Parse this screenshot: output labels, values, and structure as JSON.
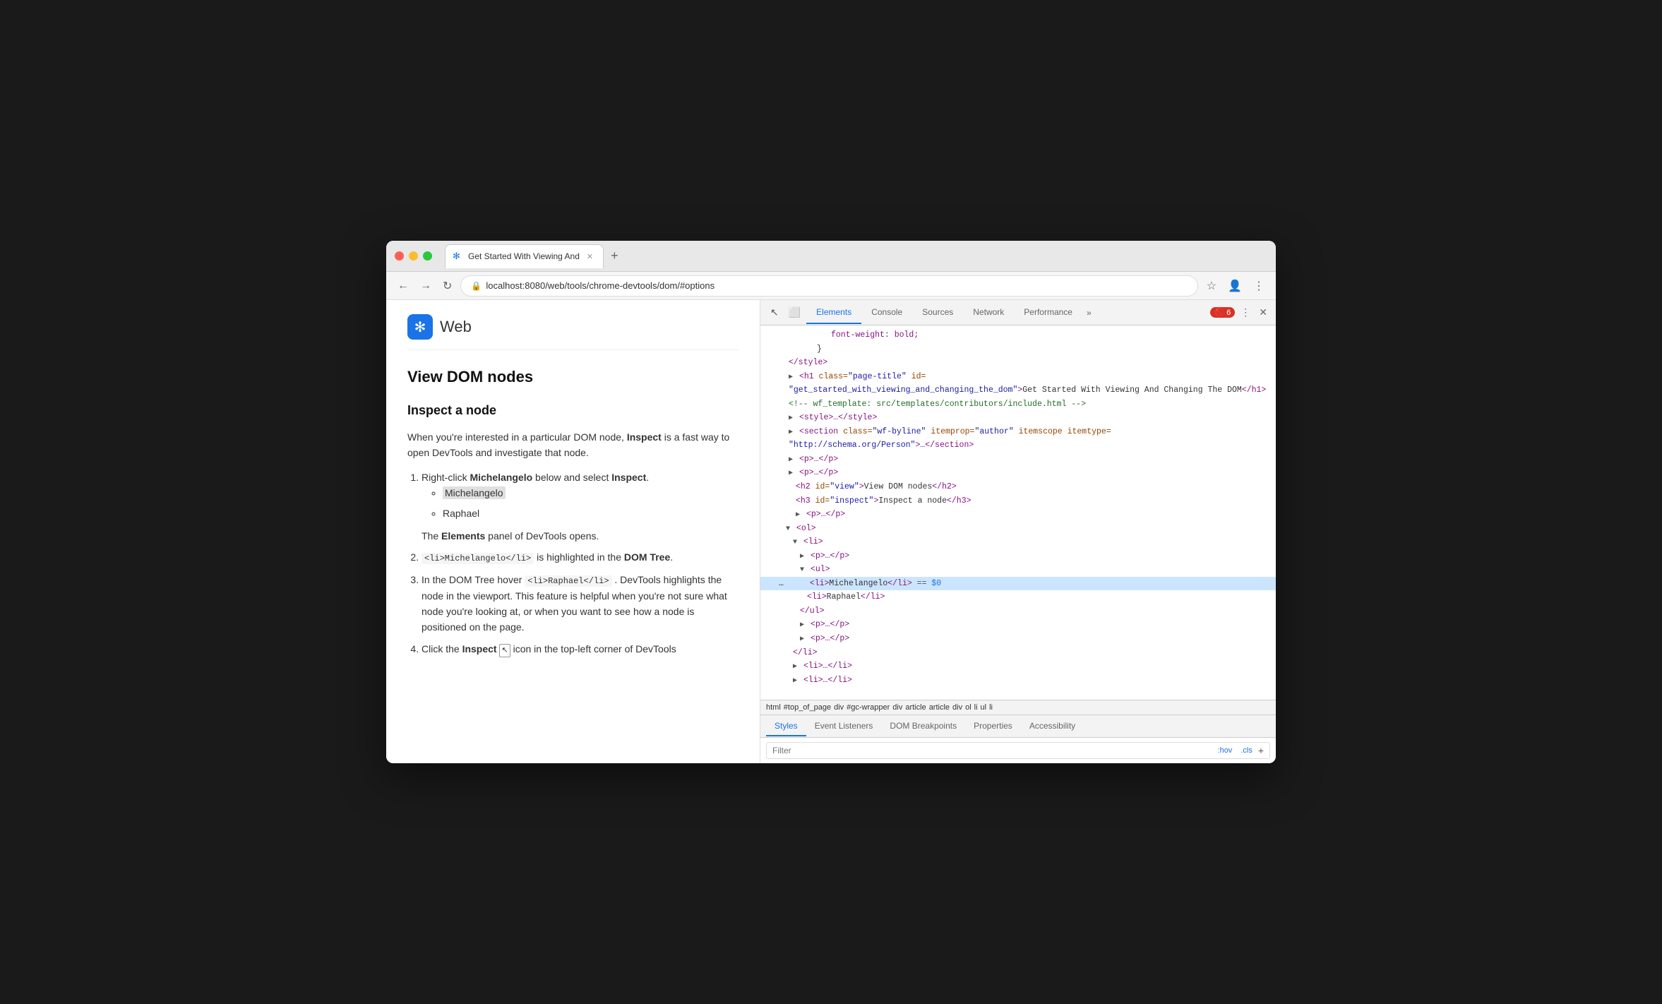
{
  "browser": {
    "tab_title": "Get Started With Viewing And",
    "tab_favicon": "⚙",
    "address": "localhost:8080/web/tools/chrome-devtools/dom/#options",
    "nav": {
      "back": "←",
      "forward": "→",
      "reload": "↻"
    }
  },
  "webpage": {
    "logo": "✻",
    "site_title": "Web",
    "heading": "View DOM nodes",
    "subheading": "Inspect a node",
    "intro": "When you're interested in a particular DOM node, Inspect is a fast way to open DevTools and investigate that node.",
    "steps": [
      {
        "text_before": "Right-click ",
        "bold1": "Michelangelo",
        "text_middle": " below and select ",
        "bold2": "Inspect",
        "text_after": ".",
        "list_items": [
          "Michelangelo",
          "Raphael"
        ],
        "highlight_index": 0
      },
      {
        "text_before": "The ",
        "bold1": "Elements",
        "text_after": " panel of DevTools opens."
      },
      {
        "code": "<li>Michelangelo</li>",
        "text_after": " is highlighted in the ",
        "bold": "DOM Tree",
        "period": "."
      },
      {
        "text_before": "In the DOM Tree hover ",
        "code": "<li>Raphael</li>",
        "text_after": " . DevTools highlights the node in the viewport. This feature is helpful when you're not sure what node you're looking at, or when you want to see how a node is positioned on the page."
      },
      {
        "text_before": "Click the ",
        "bold": "Inspect",
        "text_after": " icon in the top-left corner of DevTools"
      }
    ]
  },
  "devtools": {
    "toolbar_icons": [
      "inspect",
      "device"
    ],
    "tabs": [
      "Elements",
      "Console",
      "Sources",
      "Network",
      "Performance"
    ],
    "more_label": "»",
    "error_count": "6",
    "close_label": "✕",
    "dom_lines": [
      {
        "indent": 12,
        "content": "font-weight: bold;",
        "type": "css",
        "collapsed": false
      },
      {
        "indent": 10,
        "content": "}",
        "type": "css",
        "collapsed": false
      },
      {
        "indent": 6,
        "content": "</style>",
        "type": "close-tag",
        "collapsed": false
      },
      {
        "indent": 6,
        "content": "<h1 class=\"page-title\" id=",
        "type": "open",
        "collapsed": false
      },
      {
        "indent": 6,
        "content": "\"get_started_with_viewing_and_changing_the_dom\">Get Started With Viewing And Changing The DOM</h1>",
        "type": "text",
        "collapsed": false
      },
      {
        "indent": 6,
        "content": "<!-- wf_template: src/templates/contributors/include.html -->",
        "type": "comment",
        "collapsed": false
      },
      {
        "indent": 6,
        "content": "<style>…</style>",
        "type": "collapsed",
        "collapsed": true
      },
      {
        "indent": 6,
        "content": "<section class=\"wf-byline\" itemprop=\"author\" itemscope itemtype=",
        "type": "open",
        "collapsed": false
      },
      {
        "indent": 6,
        "content": "\"http://schema.org/Person\">…</section>",
        "type": "close",
        "collapsed": false
      },
      {
        "indent": 6,
        "content": "<p>…</p>",
        "type": "collapsed",
        "collapsed": true
      },
      {
        "indent": 6,
        "content": "<p>…</p>",
        "type": "collapsed",
        "collapsed": true
      },
      {
        "indent": 8,
        "content": "<h2 id=\"view\">View DOM nodes</h2>",
        "type": "tag",
        "collapsed": false
      },
      {
        "indent": 8,
        "content": "<h3 id=\"inspect\">Inspect a node</h3>",
        "type": "tag",
        "collapsed": false
      },
      {
        "indent": 8,
        "content": "<p>…</p>",
        "type": "collapsed",
        "collapsed": true
      },
      {
        "indent": 6,
        "content": "<ol>",
        "type": "open",
        "collapsed": false
      },
      {
        "indent": 8,
        "content": "<li>",
        "type": "open",
        "collapsed": false
      },
      {
        "indent": 10,
        "content": "<p>…</p>",
        "type": "collapsed",
        "collapsed": true
      },
      {
        "indent": 10,
        "content": "<ul>",
        "type": "open",
        "collapsed": false
      },
      {
        "indent": 14,
        "content": "<li>Michelangelo</li>  == $0",
        "type": "highlighted",
        "collapsed": false
      },
      {
        "indent": 14,
        "content": "<li>Raphael</li>",
        "type": "tag",
        "collapsed": false
      },
      {
        "indent": 12,
        "content": "</ul>",
        "type": "close-tag",
        "collapsed": false
      },
      {
        "indent": 10,
        "content": "<p>…</p>",
        "type": "collapsed",
        "collapsed": true
      },
      {
        "indent": 10,
        "content": "<p>…</p>",
        "type": "collapsed",
        "collapsed": true
      },
      {
        "indent": 8,
        "content": "</li>",
        "type": "close-tag",
        "collapsed": false
      },
      {
        "indent": 8,
        "content": "<li>…</li>",
        "type": "collapsed",
        "collapsed": true
      },
      {
        "indent": 8,
        "content": "<li>…</li>",
        "type": "collapsed",
        "collapsed": true
      }
    ],
    "breadcrumb": [
      "html",
      "#top_of_page",
      "div",
      "#gc-wrapper",
      "div",
      "article",
      "article",
      "div",
      "ol",
      "li",
      "ul",
      "li"
    ],
    "bottom_tabs": [
      "Styles",
      "Event Listeners",
      "DOM Breakpoints",
      "Properties",
      "Accessibility"
    ],
    "filter_placeholder": "Filter",
    "filter_tags": [
      ":hov",
      ".cls"
    ],
    "filter_plus": "+"
  }
}
